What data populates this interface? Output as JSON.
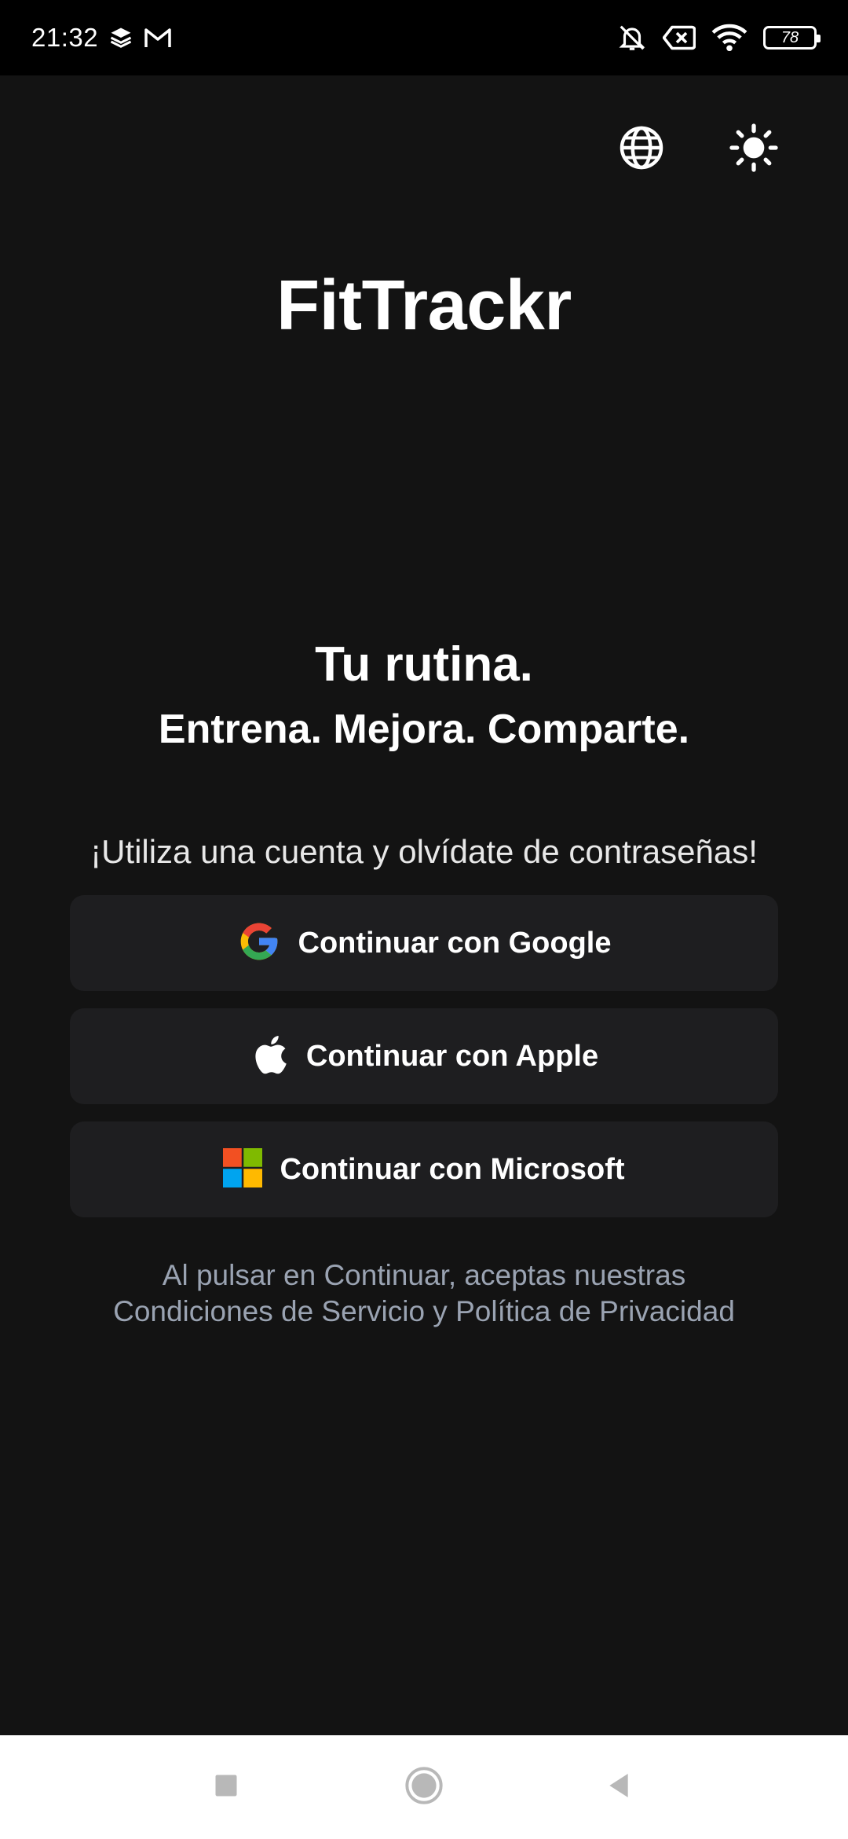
{
  "status_bar": {
    "time": "21:32",
    "left_icons": [
      "layers-icon",
      "gmail-icon"
    ],
    "right_icons": [
      "bell-off-icon",
      "no-sim-icon",
      "wifi-icon"
    ],
    "battery_level": "78"
  },
  "header": {
    "language_icon": "globe-icon",
    "theme_icon": "sun-icon"
  },
  "app": {
    "title": "FitTrackr",
    "tagline_primary": "Tu rutina.",
    "tagline_secondary": "Entrena. Mejora. Comparte.",
    "prompt": "¡Utiliza una cuenta y olvídate de contraseñas!"
  },
  "auth": {
    "google_label": "Continuar con Google",
    "apple_label": "Continuar con Apple",
    "microsoft_label": "Continuar con Microsoft"
  },
  "legal": {
    "line1": "Al pulsar en Continuar, aceptas nuestras",
    "line2": "Condiciones de Servicio y Política de Privacidad"
  },
  "colors": {
    "background": "#131313",
    "button_background": "#1e1e20",
    "legal_text": "#9aa3b2",
    "google_blue": "#4285F4",
    "google_red": "#EA4335",
    "google_yellow": "#FBBC05",
    "google_green": "#34A853",
    "ms_red": "#F25022",
    "ms_green": "#7FBA00",
    "ms_blue": "#00A4EF",
    "ms_yellow": "#FFB900"
  },
  "nav_bar": {
    "icons": [
      "recent-apps-icon",
      "home-icon",
      "back-icon"
    ]
  }
}
